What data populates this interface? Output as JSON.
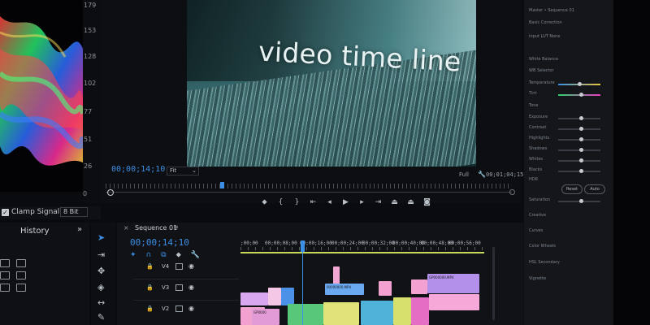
{
  "scope": {
    "scale_labels": [
      "179",
      "153",
      "128",
      "102",
      "77",
      "51",
      "26",
      "0"
    ],
    "clamp_label": "Clamp Signal",
    "bit_depth": "8 Bit"
  },
  "monitor": {
    "video_caption": "video time line",
    "current_timecode": "00;00;14;10",
    "zoom": "Fit",
    "resolution": "Full",
    "duration_timecode": "00;01;04;15"
  },
  "transport_icons": [
    "marker-icon",
    "mark-in-icon",
    "mark-out-icon",
    "go-to-in-icon",
    "step-back-icon",
    "play-icon",
    "step-forward-icon",
    "go-to-out-icon",
    "lift-icon",
    "extract-icon",
    "export-frame-icon"
  ],
  "history": {
    "title": "History",
    "more": "»"
  },
  "timeline": {
    "sequence_tab": "Sequence 01",
    "close": "×",
    "menu": "≡",
    "timecode": "00;00;14;10",
    "ruler_labels": [
      ";00;00",
      "00;00;08;00",
      "00;00;16;00",
      "00;00;24;00",
      "00;00;32;00",
      "00;00;40;00",
      "00;00;48;00",
      "00;00;56;00"
    ],
    "tracks": [
      {
        "name": "V4"
      },
      {
        "name": "V3"
      },
      {
        "name": "V2"
      }
    ],
    "clips": [
      {
        "label": "",
        "color": "#f2a6d3",
        "track": 0
      },
      {
        "label": "",
        "color": "#d9a7f0",
        "track": 1
      },
      {
        "label": "",
        "color": "#f5c7e6",
        "track": 1
      },
      {
        "label": "",
        "color": "#4b91e8",
        "track": 1
      },
      {
        "label": "00000000.MP4",
        "color": "#6aa8f0",
        "track": 1
      },
      {
        "label": "",
        "color": "#f3a1d0",
        "track": 1
      },
      {
        "label": "",
        "color": "#f3a1d0",
        "track": 1
      },
      {
        "label": "GP000000.MP4",
        "color": "#b390ea",
        "track": 1
      },
      {
        "label": "",
        "color": "#f3a1d0",
        "track": 2
      },
      {
        "label": "GP0000",
        "color": "#e39bd5",
        "track": 2
      },
      {
        "label": "",
        "color": "#59c77a",
        "track": 2
      },
      {
        "label": "",
        "color": "#e0e37a",
        "track": 2
      },
      {
        "label": "",
        "color": "#4fb2d8",
        "track": 2
      },
      {
        "label": "",
        "color": "#d7e06d",
        "track": 2
      },
      {
        "label": "",
        "color": "#e36ec4",
        "track": 2
      },
      {
        "label": "",
        "color": "#f6a9d8",
        "track": 2
      }
    ]
  },
  "lumetri": {
    "rows": [
      "Basic Correction",
      "Input LUT  None",
      "White Balance",
      "WB Selector",
      "Temperature",
      "Tint",
      "Tone",
      "Exposure",
      "Contrast",
      "Highlights",
      "Shadows",
      "Whites",
      "Blacks",
      "HDR",
      "Reset",
      "Auto",
      "Saturation",
      "Creative",
      "Curves",
      "Color Wheels",
      "HSL Secondary",
      "Vignette"
    ],
    "reset": "Reset",
    "auto": "Auto",
    "header": "Master • Sequence 01"
  },
  "colors": {
    "accent": "#3b8fe6",
    "work_area": "#c7d85a",
    "panel_bg": "#111216"
  }
}
